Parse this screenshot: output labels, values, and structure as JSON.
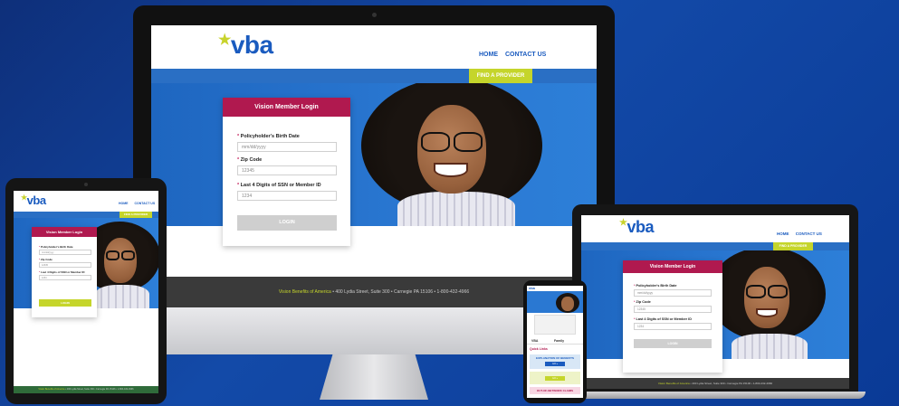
{
  "brand": {
    "logo_text": "vba",
    "star_glyph": "★"
  },
  "nav": {
    "home": "HOME",
    "contact": "CONTACT US"
  },
  "provider_button": "FIND A PROVIDER",
  "login": {
    "title": "Vision Member Login",
    "birth_label": "Policyholder's Birth Date",
    "birth_placeholder": "mm/dd/yyyy",
    "zip_label": "Zip Code",
    "zip_value": "12345",
    "ssn_label": "Last 4 Digits of SSN or Member ID",
    "ssn_value": "1234",
    "submit": "LOGIN",
    "required_mark": "*"
  },
  "footer": {
    "brand": "Vision Benefits of America",
    "address": "•  400 Lydia Street, Suite 300  •  Carnegie PA 15106  •  1-800-432-4966"
  },
  "phone": {
    "tab_vba": "VBA",
    "tab_family": "Family",
    "quick_links": "Quick Links",
    "eob_title": "EXPLANATION OF BENEFITS",
    "eob_btn": "GO »",
    "claims_btn": "GO »",
    "oon_claims": "OUT-OF-NETWORK CLAIMS"
  },
  "colors": {
    "brand_blue": "#1a5bbf",
    "accent_green": "#c5d52b",
    "login_magenta": "#b0194f",
    "background": "#134aa8"
  }
}
